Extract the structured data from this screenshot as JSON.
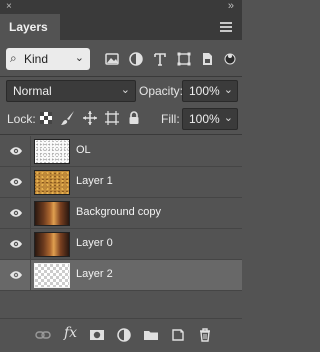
{
  "window": {
    "close_glyph": "×",
    "collapse_glyph": "»"
  },
  "panel": {
    "tab_title": "Layers"
  },
  "filter": {
    "kind_label": "Kind",
    "icons": [
      "image-filter-icon",
      "adjustment-filter-icon",
      "type-filter-icon",
      "shape-filter-icon",
      "smart-object-filter-icon",
      "filter-toggle-icon"
    ]
  },
  "blend": {
    "mode": "Normal",
    "opacity_label": "Opacity:",
    "opacity_value": "100%"
  },
  "lock": {
    "label": "Lock:",
    "fill_label": "Fill:",
    "fill_value": "100%"
  },
  "layers": [
    {
      "name": "OL",
      "visible": true,
      "selected": false,
      "thumb": "white-speckle"
    },
    {
      "name": "Layer 1",
      "visible": true,
      "selected": false,
      "thumb": "gold-texture"
    },
    {
      "name": "Background copy",
      "visible": true,
      "selected": false,
      "thumb": "interior-photo"
    },
    {
      "name": "Layer 0",
      "visible": true,
      "selected": false,
      "thumb": "interior-photo"
    },
    {
      "name": "Layer 2",
      "visible": true,
      "selected": true,
      "thumb": "transparent"
    }
  ],
  "footer": {
    "fx_label": "fx"
  },
  "colors": {
    "panel_bg": "#535353",
    "selected_row": "#686868",
    "tab_bar": "#3a3a3a"
  }
}
